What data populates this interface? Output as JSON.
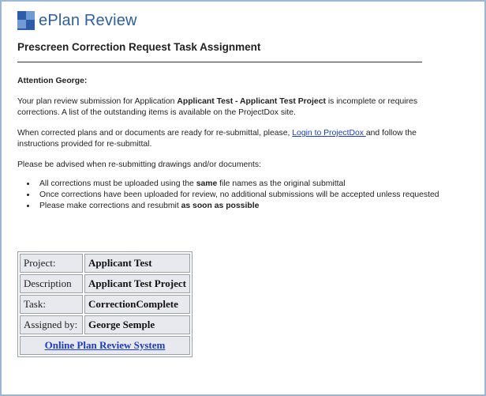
{
  "header": {
    "logo_icon": "eplan-review-logo-icon",
    "app_name": "ePlan Review"
  },
  "page_title": "Prescreen Correction Request Task Assignment",
  "message": {
    "attention": "Attention George:",
    "p1_before": "Your plan review submission for Application ",
    "p1_bold": "Applicant Test - Applicant Test Project",
    "p1_after": " is incomplete or requires corrections. A list of the outstanding items is available on the ProjectDox site.",
    "p2_before": "When corrected plans and or documents are ready for re-submittal, please, ",
    "p2_link": "Login to ProjectDox ",
    "p2_after": "and follow the instructions provided for re-submittal.",
    "p3": "Please be advised when re-submitting drawings and/or documents:",
    "bullet1_before": "All corrections must be uploaded using the ",
    "bullet1_bold": "same",
    "bullet1_after": " file names as the original submittal",
    "bullet2": "Once corrections have been uploaded for review, no additional submissions will be accepted unless requested",
    "bullet3_before": "Please make corrections and resubmit ",
    "bullet3_bold": "as soon as possible"
  },
  "summary_table": {
    "rows": [
      {
        "label": "Project:",
        "value": "Applicant Test"
      },
      {
        "label": "Description",
        "value": "Applicant Test Project"
      },
      {
        "label": "Task:",
        "value": "CorrectionComplete"
      },
      {
        "label": "Assigned by:",
        "value": "George Semple"
      }
    ],
    "link": "Online Plan Review System"
  },
  "colors": {
    "brand": "#2e5f9e",
    "link": "#1a3cc8",
    "frame_border": "#9bb7d6",
    "table_cell_bg": "#e8e9ee"
  }
}
